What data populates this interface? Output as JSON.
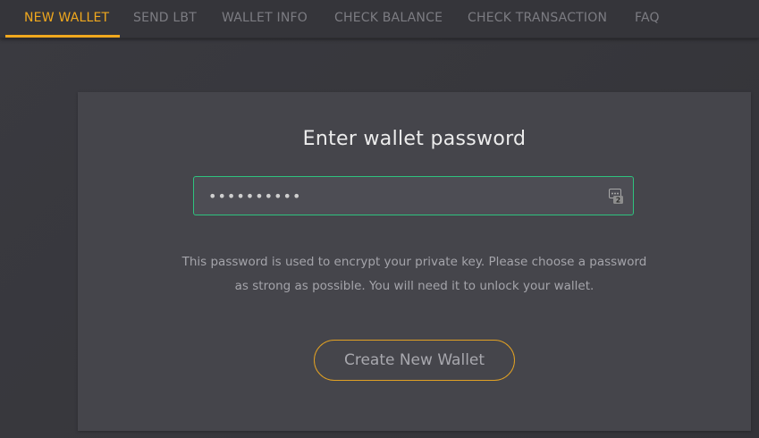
{
  "nav": {
    "tabs": [
      {
        "label": "NEW WALLET",
        "active": true
      },
      {
        "label": "SEND LBT",
        "active": false
      },
      {
        "label": "WALLET INFO",
        "active": false
      },
      {
        "label": "CHECK BALANCE",
        "active": false
      },
      {
        "label": "CHECK TRANSACTION",
        "active": false
      },
      {
        "label": "FAQ",
        "active": false
      }
    ]
  },
  "card": {
    "title": "Enter wallet password",
    "password_value": "••••••••••",
    "password_manager_badge": "2",
    "description_lines": [
      "This password is used to encrypt your private key. Please choose a password",
      "as strong as possible. You will need it to unlock your wallet."
    ],
    "create_button_label": "Create New Wallet"
  },
  "colors": {
    "accent": "#f0a81e",
    "input_border_focus": "#2ec27e",
    "background": "#37373c",
    "card": "#45454b"
  },
  "icons": {
    "password_field": "password-manager-icon"
  }
}
